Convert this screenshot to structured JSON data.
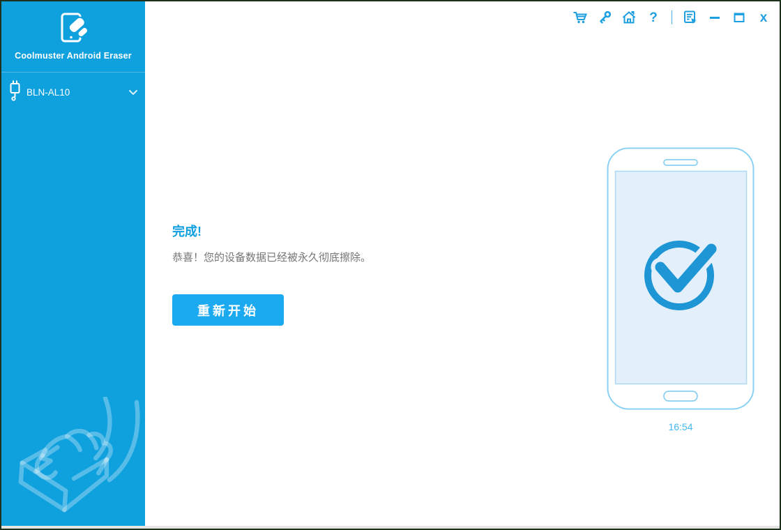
{
  "window": {
    "border_color": "#1d311d"
  },
  "sidebar": {
    "bg_color": "#0fa0de",
    "app_name": "Coolmuster Android Eraser",
    "logo_icon": "phone-eraser-logo",
    "device": {
      "name": "BLN-AL10",
      "icon": "usb-plug-icon",
      "expander_icon": "chevron-down-icon"
    },
    "watermark_icon": "hand-erasing-watermark"
  },
  "titlebar": {
    "icon_color": "#1e9fe0",
    "icons": [
      "cart-icon",
      "key-icon",
      "home-icon",
      "help-icon",
      "register-icon",
      "minimize-icon",
      "maximize-icon",
      "close-icon"
    ],
    "help_glyph": "?",
    "close_glyph": "x"
  },
  "main": {
    "done_title": "完成!",
    "message": "恭喜！您的设备数据已经被永久彻底擦除。",
    "restart_label": "重新开始",
    "accent_color": "#1ba9ef",
    "phone": {
      "illustration": "phone-with-checkmark",
      "check_color": "#1e96d6",
      "time": "16:54"
    }
  }
}
